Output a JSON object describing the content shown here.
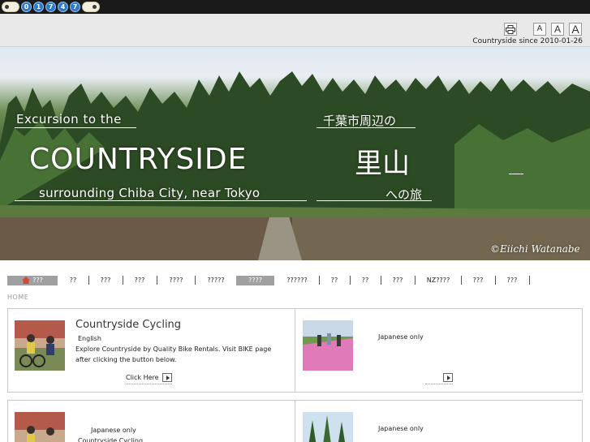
{
  "counter": {
    "digits": [
      "0",
      "1",
      "7",
      "4",
      "7"
    ]
  },
  "header": {
    "since_text": "Countryside since 2010-01-26",
    "font_small": "A",
    "font_medium": "A",
    "font_large": "A"
  },
  "hero": {
    "line1_en": "Excursion to the",
    "line1_jp": "千葉市周辺の",
    "title_en": "COUNTRYSIDE",
    "title_jp": "里山",
    "line3_en": "surrounding Chiba City, near Tokyo",
    "line3_jp": "への旅",
    "copyright": "©Eiichi Watanabe"
  },
  "nav": {
    "items": [
      {
        "label": "???"
      },
      {
        "label": "??"
      },
      {
        "label": "???"
      },
      {
        "label": "???"
      },
      {
        "label": "????"
      },
      {
        "label": "?????"
      },
      {
        "label": "????"
      },
      {
        "label": "??????"
      },
      {
        "label": "??"
      },
      {
        "label": "??"
      },
      {
        "label": "???"
      },
      {
        "label": "NZ????"
      },
      {
        "label": "???"
      },
      {
        "label": "???"
      }
    ]
  },
  "breadcrumb": "HOME",
  "boxes": {
    "cycling": {
      "title": "Countryside Cycling",
      "lang": "English",
      "body": "Explore Countryside by Quality Bike Rentals. Visit BIKE page after clicking the button below.",
      "cta": "Click Here"
    },
    "right1": {
      "note": "Japanese only"
    },
    "left2": {
      "note": "Japanese only",
      "sub": "Countryside Cycling"
    },
    "right2": {
      "note": "Japanese only"
    }
  },
  "colors": {
    "nav_active": "#a0a0a0",
    "header_bg": "#e9e9e9",
    "topbar": "#1a1a1a",
    "counter_digit": "#2f78c7"
  }
}
